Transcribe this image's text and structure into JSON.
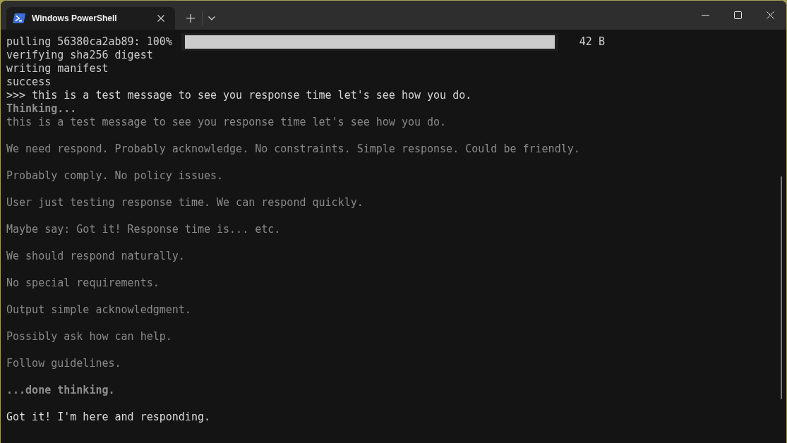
{
  "window": {
    "tabs": [
      {
        "title": "Windows PowerShell",
        "selected": true
      }
    ]
  },
  "terminal": {
    "progress": {
      "label": "pulling 56380ca2ab89: 100%",
      "level": 1,
      "size": "42 B"
    },
    "lines": [
      {
        "kind": "output",
        "text": "verifying sha256 digest"
      },
      {
        "kind": "output",
        "text": "writing manifest"
      },
      {
        "kind": "output",
        "text": "success"
      },
      {
        "kind": "prompt",
        "text": ">>> this is a test message to see you response time let's see how you do."
      },
      {
        "kind": "thinking-start",
        "text": "Thinking..."
      },
      {
        "kind": "thought",
        "text": "this is a test message to see you response time let's see how you do."
      },
      {
        "kind": "blank"
      },
      {
        "kind": "thought",
        "text": "We need respond. Probably acknowledge. No constraints. Simple response. Could be friendly."
      },
      {
        "kind": "blank"
      },
      {
        "kind": "thought",
        "text": "Probably comply. No policy issues."
      },
      {
        "kind": "blank"
      },
      {
        "kind": "thought",
        "text": "User just testing response time. We can respond quickly."
      },
      {
        "kind": "blank"
      },
      {
        "kind": "thought",
        "text": "Maybe say: Got it! Response time is... etc."
      },
      {
        "kind": "blank"
      },
      {
        "kind": "thought",
        "text": "We should respond naturally."
      },
      {
        "kind": "blank"
      },
      {
        "kind": "thought",
        "text": "No special requirements."
      },
      {
        "kind": "blank"
      },
      {
        "kind": "thought",
        "text": "Output simple acknowledgment."
      },
      {
        "kind": "blank"
      },
      {
        "kind": "thought",
        "text": "Possibly ask how can help."
      },
      {
        "kind": "blank"
      },
      {
        "kind": "thought",
        "text": "Follow guidelines."
      },
      {
        "kind": "blank"
      },
      {
        "kind": "thinking-end",
        "text": "...done thinking."
      },
      {
        "kind": "blank"
      },
      {
        "kind": "answer",
        "text": "Got it! I'm here and responding."
      }
    ]
  }
}
